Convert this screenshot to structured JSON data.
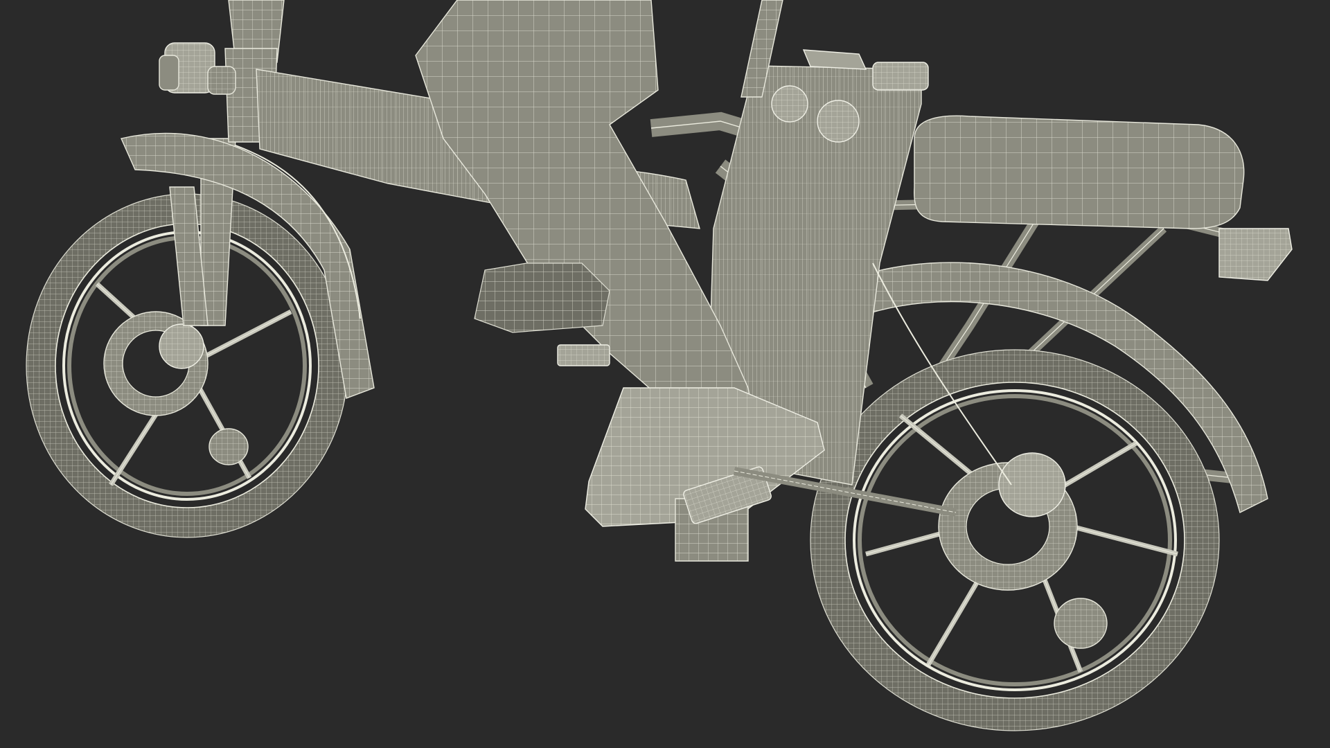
{
  "scene": {
    "subject": "folding-electric-bicycle-wireframe-with-rider-leg",
    "colors": {
      "background": "#2a2a2a",
      "mesh_fill": "#8c8c80",
      "mesh_dark": "#6e6e64",
      "wire": "#ececdf"
    }
  }
}
